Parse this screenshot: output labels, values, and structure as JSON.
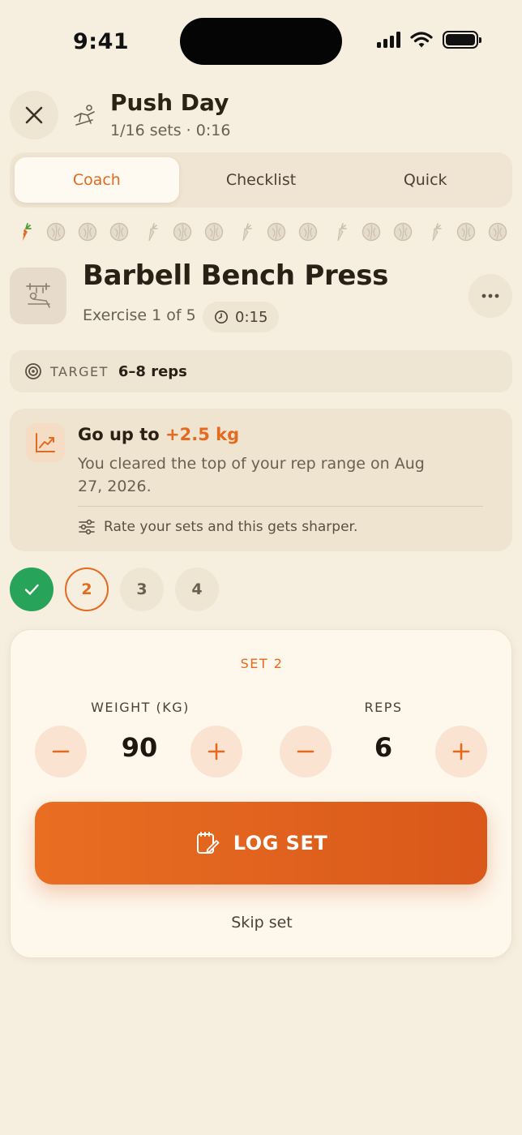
{
  "status_bar": {
    "time": "9:41"
  },
  "header": {
    "title": "Push Day",
    "subtitle": "1/16 sets · 0:16"
  },
  "tabs": [
    {
      "label": "Coach",
      "active": true
    },
    {
      "label": "Checklist",
      "active": false
    },
    {
      "label": "Quick",
      "active": false
    }
  ],
  "progress_icons": [
    "carrot-icon",
    "cabbage-icon",
    "cabbage-icon",
    "cabbage-icon",
    "carrot-icon",
    "cabbage-icon",
    "cabbage-icon",
    "carrot-icon",
    "cabbage-icon",
    "cabbage-icon",
    "carrot-icon",
    "cabbage-icon",
    "cabbage-icon",
    "carrot-icon",
    "cabbage-icon",
    "cabbage-icon"
  ],
  "exercise": {
    "title": "Barbell Bench Press",
    "count": "Exercise 1 of 5",
    "timer": "0:15"
  },
  "target": {
    "label": "TARGET",
    "value": "6–8 reps"
  },
  "coach": {
    "head_prefix": "Go up to",
    "head_accent": "+2.5 kg",
    "body": "You cleared the top of your rep range on Aug 27, 2026.",
    "tip": "Rate your sets and this gets sharper."
  },
  "sets": [
    {
      "label": "",
      "state": "done"
    },
    {
      "label": "2",
      "state": "current"
    },
    {
      "label": "3",
      "state": "upcoming"
    },
    {
      "label": "4",
      "state": "upcoming"
    }
  ],
  "set_card": {
    "title": "SET 2",
    "weight_label": "WEIGHT (KG)",
    "weight_value": "90",
    "reps_label": "REPS",
    "reps_value": "6",
    "log_label": "LOG SET",
    "skip_label": "Skip set"
  },
  "colors": {
    "accent": "#e36a1f",
    "success": "#27a35a",
    "background": "#f6eedf"
  }
}
